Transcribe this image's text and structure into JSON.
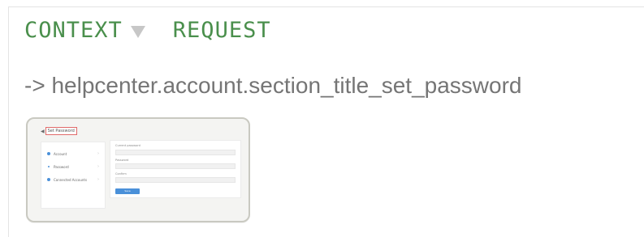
{
  "tabs": {
    "context_label": "CONTEXT",
    "request_label": "REQUEST"
  },
  "translation_key": "-> helpcenter.account.section_title_set_password",
  "screenshot_thumbnail": {
    "title": "Set Password",
    "sidebar_items": [
      {
        "label": "Account",
        "icon": "user-icon"
      },
      {
        "label": "Password",
        "icon": "key-icon"
      },
      {
        "label": "Connected Accounts",
        "icon": "link-icon"
      }
    ],
    "form_fields": [
      {
        "label": "Current password"
      },
      {
        "label": "Password"
      },
      {
        "label": "Confirm"
      }
    ],
    "submit_label": "Save",
    "accent_color": "#4a90d9",
    "highlight_color": "#e06a6a"
  },
  "colors": {
    "tab_text": "#4a8f4c",
    "key_text": "#757575",
    "caret": "#c7c7c7"
  }
}
